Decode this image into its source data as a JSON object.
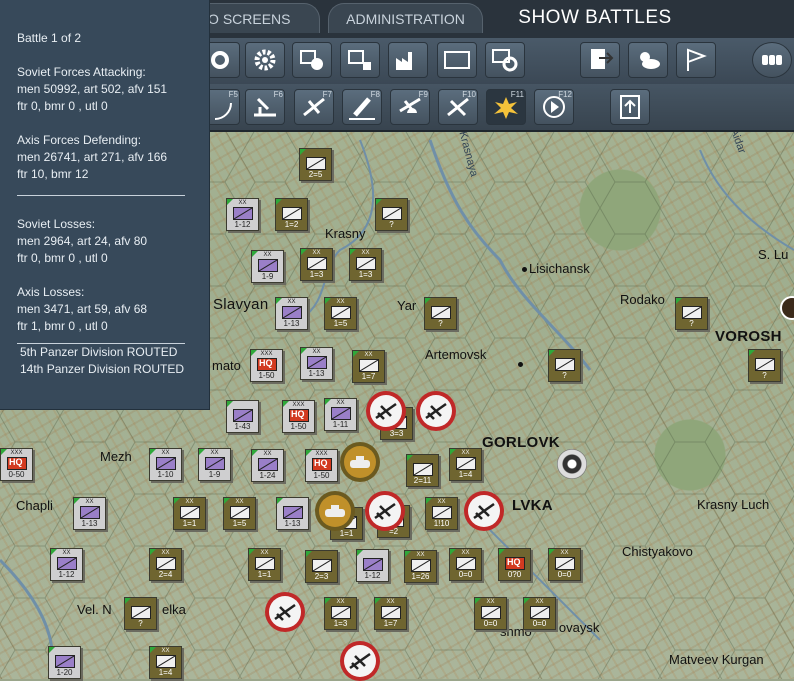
{
  "topbar": {
    "tab_info": "FO SCREENS",
    "tab_admin": "ADMINISTRATION",
    "tab_battles": "SHOW BATTLES"
  },
  "toolbar2_keys": [
    "F5",
    "F6",
    "F7",
    "F8",
    "F9",
    "F10",
    "F11",
    "F12"
  ],
  "panel": {
    "battle": "Battle  1  of 2",
    "attack_title": "Soviet Forces Attacking:",
    "attack_line1": "men  50992,  art  502,  afv  151",
    "attack_line2": "ftr  0,  bmr  0 ,  utl  0",
    "defend_title": "Axis Forces Defending:",
    "defend_line1": "men  26741,  art  271,  afv  166",
    "defend_line2": "ftr  10,  bmr  12",
    "sov_loss_title": "Soviet Losses:",
    "sov_loss_line1": "men  2964,  art  24,  afv  80",
    "sov_loss_line2": "ftr  0,  bmr  0 ,  utl  0",
    "axis_loss_title": "Axis Losses:",
    "axis_loss_line1": "men  3471,  art  59,  afv  68",
    "axis_loss_line2": " ftr  1,  bmr  0 ,  utl  0",
    "routed1": "5th Panzer Division ROUTED",
    "routed2": "14th Panzer Division ROUTED"
  },
  "places": {
    "krasny": "Krasny",
    "lisichansk": "Lisichansk",
    "slavyan": "Slavyan",
    "yar": "Yar",
    "rodako": "Rodako",
    "vorosh": "VOROSH",
    "artemovsk": "Artemovsk",
    "mato": "mato",
    "gorlovk": "GORLOVK",
    "mezh": "Mezh",
    "chapli": "Chapli",
    "lvka": "LVKA",
    "krasny_luch": "Krasny Luch",
    "chistyakovo": "Chistyakovo",
    "vel_n": "Vel. N",
    "elka": "elka",
    "matveev": "Matveev Kurgan",
    "ilovaysk": "lovaysk",
    "snmo": "snmo",
    "s_lu": "S. Lu",
    "krasnaya": "Krasnaya",
    "aidar": "Aidar"
  },
  "counters": [
    {
      "id": "c1",
      "side": "axis",
      "size": "",
      "val": "2=5"
    },
    {
      "id": "c2",
      "side": "sov",
      "size": "XX",
      "val": "1-12"
    },
    {
      "id": "c3",
      "side": "axis",
      "size": "",
      "val": "1=2"
    },
    {
      "id": "c4",
      "side": "axis",
      "size": "",
      "val": "?"
    },
    {
      "id": "c5",
      "side": "sov",
      "size": "XX",
      "val": "1-9"
    },
    {
      "id": "c6",
      "side": "axis",
      "size": "XX",
      "val": "1=3"
    },
    {
      "id": "c7",
      "side": "axis",
      "size": "XX",
      "val": "1=3"
    },
    {
      "id": "c8",
      "side": "sov",
      "size": "XX",
      "val": "1-13"
    },
    {
      "id": "c9",
      "side": "axis",
      "size": "XX",
      "val": "1=5"
    },
    {
      "id": "c10",
      "side": "axis",
      "size": "",
      "val": "?"
    },
    {
      "id": "c11",
      "side": "axis",
      "size": "",
      "val": "?"
    },
    {
      "id": "c12",
      "side": "sov",
      "size": "XXX",
      "val": "1-50",
      "hq": "HQ"
    },
    {
      "id": "c13",
      "side": "sov",
      "size": "XX",
      "val": "1-13"
    },
    {
      "id": "c14",
      "side": "axis",
      "size": "XX",
      "val": "1=7"
    },
    {
      "id": "c15",
      "side": "axis",
      "size": "",
      "val": "?"
    },
    {
      "id": "c16",
      "side": "axis",
      "size": "",
      "val": "?"
    },
    {
      "id": "c17",
      "side": "sov",
      "size": "",
      "val": "1-43"
    },
    {
      "id": "c18",
      "side": "sov",
      "size": "XXX",
      "val": "1-50",
      "hq": "HQ"
    },
    {
      "id": "c19",
      "side": "sov",
      "size": "XX",
      "val": "1-11"
    },
    {
      "id": "c20",
      "side": "axis",
      "size": "",
      "val": "3=3"
    },
    {
      "id": "c21",
      "side": "sov",
      "size": "XXX",
      "val": "0-50",
      "hq": "HQ"
    },
    {
      "id": "c22",
      "side": "sov",
      "size": "XX",
      "val": "1-10"
    },
    {
      "id": "c23",
      "side": "sov",
      "size": "XX",
      "val": "1-9"
    },
    {
      "id": "c24",
      "side": "sov",
      "size": "XX",
      "val": "1-24"
    },
    {
      "id": "c25",
      "side": "sov",
      "size": "XXX",
      "val": "1-50",
      "hq": "HQ"
    },
    {
      "id": "c26",
      "side": "axis",
      "size": "",
      "val": "2=11"
    },
    {
      "id": "c27",
      "side": "axis",
      "size": "XX",
      "val": "1=4"
    },
    {
      "id": "c28",
      "side": "sov",
      "size": "XX",
      "val": "1-13"
    },
    {
      "id": "c29",
      "side": "axis",
      "size": "XX",
      "val": "1=1"
    },
    {
      "id": "c30",
      "side": "axis",
      "size": "XX",
      "val": "1=5"
    },
    {
      "id": "c31",
      "side": "sov",
      "size": "",
      "val": "1-13"
    },
    {
      "id": "c32",
      "side": "axis",
      "size": "",
      "val": "1=1"
    },
    {
      "id": "c33",
      "side": "axis",
      "size": "",
      "val": "=2"
    },
    {
      "id": "c34",
      "side": "axis",
      "size": "XX",
      "val": "1!10"
    },
    {
      "id": "c35",
      "side": "sov",
      "size": "XX",
      "val": "1-12"
    },
    {
      "id": "c36",
      "side": "axis",
      "size": "XX",
      "val": "2=4"
    },
    {
      "id": "c37",
      "side": "axis",
      "size": "XX",
      "val": "1=1"
    },
    {
      "id": "c38",
      "side": "axis",
      "size": "",
      "val": "2=3"
    },
    {
      "id": "c39",
      "side": "sov",
      "size": "",
      "val": "1-12"
    },
    {
      "id": "c40",
      "side": "axis",
      "size": "XX",
      "val": "1=26"
    },
    {
      "id": "c41",
      "side": "axis",
      "size": "XX",
      "val": "0=0"
    },
    {
      "id": "c42",
      "side": "axis",
      "size": "",
      "val": "0?0",
      "hq": "HQ"
    },
    {
      "id": "c43",
      "side": "axis",
      "size": "XX",
      "val": "0=0"
    },
    {
      "id": "c44",
      "side": "axis",
      "size": "",
      "val": "?"
    },
    {
      "id": "c45",
      "side": "axis",
      "size": "XX",
      "val": "1=3"
    },
    {
      "id": "c46",
      "side": "axis",
      "size": "XX",
      "val": "1=7"
    },
    {
      "id": "c47",
      "side": "axis",
      "size": "XX",
      "val": "0=0"
    },
    {
      "id": "c48",
      "side": "axis",
      "size": "XX",
      "val": "0=0"
    },
    {
      "id": "c49",
      "side": "sov",
      "size": "",
      "val": "1-20"
    },
    {
      "id": "c50",
      "side": "axis",
      "size": "XX",
      "val": "1=4"
    },
    {
      "id": "c51",
      "side": "axis",
      "size": "",
      "val": "?"
    },
    {
      "id": "c52",
      "side": "axis",
      "size": "",
      "val": "?"
    }
  ]
}
